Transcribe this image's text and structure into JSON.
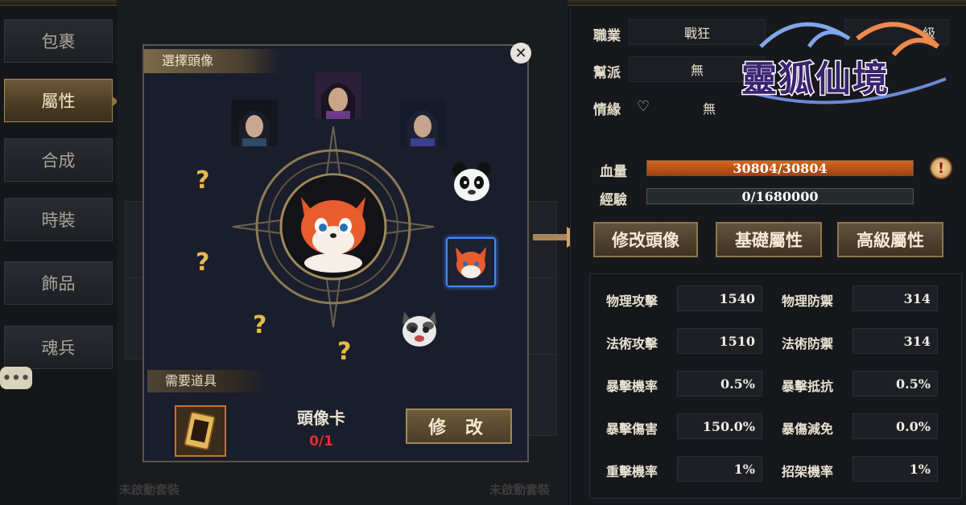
{
  "tabs": [
    {
      "label": "包裹",
      "active": false
    },
    {
      "label": "屬性",
      "active": true
    },
    {
      "label": "合成",
      "active": false
    },
    {
      "label": "時裝",
      "active": false
    },
    {
      "label": "飾品",
      "active": false
    },
    {
      "label": "魂兵",
      "active": false
    }
  ],
  "chat_icon": "chat-bubble-icon",
  "background": {
    "inactive_set_label": "未啟動套裝"
  },
  "modal": {
    "title": "選擇頭像",
    "close_icon": "close-icon",
    "unknown_slot_text": "?",
    "required_title": "需要道具",
    "item_name": "頭像卡",
    "item_count": "0/1",
    "modify_label": "修 改"
  },
  "profile": {
    "job_label": "職業",
    "job_value": "戰狂",
    "level_value": "級",
    "guild_label": "幫派",
    "guild_value": "無",
    "bond_label": "情緣",
    "bond_value": "無",
    "hp_label": "血量",
    "hp_value": "30804/30804",
    "hp_fraction": 1.0,
    "exp_label": "經驗",
    "exp_value": "0/1680000",
    "exp_fraction": 0.0
  },
  "buttons": {
    "change_avatar": "修改頭像",
    "basic_attr": "基礎屬性",
    "advanced_attr": "高級屬性"
  },
  "stats": [
    {
      "label": "物理攻擊",
      "value": "1540"
    },
    {
      "label": "物理防禦",
      "value": "314"
    },
    {
      "label": "法術攻擊",
      "value": "1510"
    },
    {
      "label": "法術防禦",
      "value": "314"
    },
    {
      "label": "暴擊機率",
      "value": "0.5%"
    },
    {
      "label": "暴擊抵抗",
      "value": "0.5%"
    },
    {
      "label": "暴擊傷害",
      "value": "150.0%"
    },
    {
      "label": "暴傷減免",
      "value": "0.0%"
    },
    {
      "label": "重擊機率",
      "value": "1%"
    },
    {
      "label": "招架機率",
      "value": "1%"
    }
  ],
  "logo": {
    "text": "靈狐仙境"
  },
  "colors": {
    "accent_gold": "#a98a55",
    "hp_orange": "#d46a1e",
    "count_red": "#e0302c",
    "selected_blue": "#3f88ff",
    "question_gold": "#e7b94b"
  }
}
